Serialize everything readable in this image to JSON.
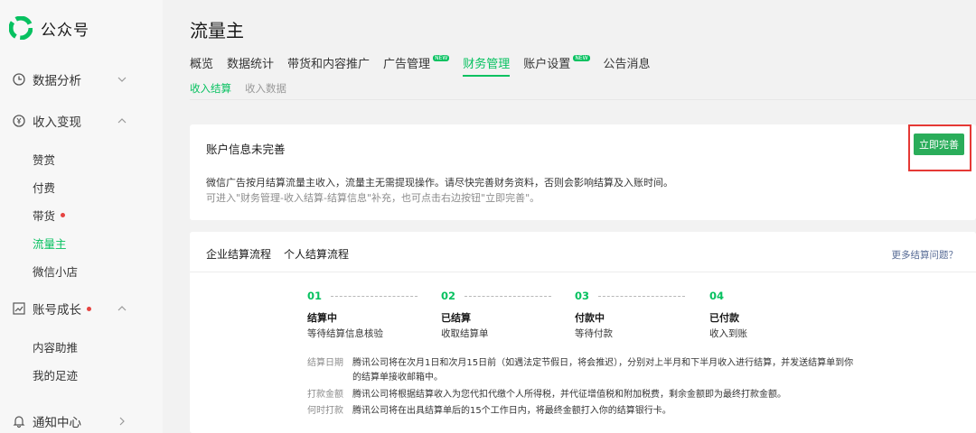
{
  "brand": {
    "name": "公众号",
    "logo_color": "#07c160"
  },
  "sidebar": {
    "groups": [
      {
        "label": "数据分析",
        "icon": "clock-icon",
        "expanded": false,
        "dot": false
      },
      {
        "label": "收入变现",
        "icon": "yuan-icon",
        "expanded": true,
        "dot": false
      },
      {
        "label": "账号成长",
        "icon": "chart-icon",
        "expanded": true,
        "dot": true
      },
      {
        "label": "通知中心",
        "icon": "bell-icon",
        "expanded": false,
        "dot": false
      }
    ],
    "income_items": [
      {
        "label": "赞赏",
        "active": false,
        "dot": false
      },
      {
        "label": "付费",
        "active": false,
        "dot": false
      },
      {
        "label": "带货",
        "active": false,
        "dot": true
      },
      {
        "label": "流量主",
        "active": true,
        "dot": false
      },
      {
        "label": "微信小店",
        "active": false,
        "dot": false
      }
    ],
    "growth_items": [
      {
        "label": "内容助推"
      },
      {
        "label": "我的足迹"
      }
    ]
  },
  "main": {
    "title": "流量主",
    "tabs": [
      {
        "label": "概览",
        "active": false,
        "new": false
      },
      {
        "label": "数据统计",
        "active": false,
        "new": false
      },
      {
        "label": "带货和内容推广",
        "active": false,
        "new": false
      },
      {
        "label": "广告管理",
        "active": false,
        "new": true
      },
      {
        "label": "财务管理",
        "active": true,
        "new": false
      },
      {
        "label": "账户设置",
        "active": false,
        "new": true
      },
      {
        "label": "公告消息",
        "active": false,
        "new": false
      }
    ],
    "new_badge": "NEW",
    "subtabs": [
      {
        "label": "收入结算",
        "active": true
      },
      {
        "label": "收入数据",
        "active": false
      }
    ]
  },
  "notice": {
    "title": "账户信息未完善",
    "desc1": "微信广告按月结算流量主收入，流量主无需提现操作。请尽快完善财务资料，否则会影响结算及入账时间。",
    "desc2": "可进入\"财务管理-收入结算-结算信息\"补充，也可点击右边按钮\"立即完善\"。",
    "button": "立即完善"
  },
  "flow": {
    "tabs": [
      "企业结算流程",
      "个人结算流程"
    ],
    "more_link": "更多结算问题？",
    "steps": [
      {
        "num": "01",
        "title": "结算中",
        "desc": "等待结算信息核验"
      },
      {
        "num": "02",
        "title": "已结算",
        "desc": "收取结算单"
      },
      {
        "num": "03",
        "title": "付款中",
        "desc": "等待付款"
      },
      {
        "num": "04",
        "title": "已付款",
        "desc": "收入到账"
      }
    ],
    "rows": [
      {
        "label": "结算日期",
        "text": "腾讯公司将在次月1日和次月15日前（如遇法定节假日，将会推迟），分别对上半月和下半月收入进行结算，并发送结算单到你"
      },
      {
        "label": "",
        "text": "的结算单接收邮箱中。"
      },
      {
        "label": "打款金额",
        "text": "腾讯公司将根据结算收入为您代扣代缴个人所得税，并代征增值税和附加税费，剩余金额即为最终打款金额。"
      },
      {
        "label": "何时打款",
        "text": "腾讯公司将在出具结算单后的15个工作日内，将最终金额打入你的结算银行卡。"
      }
    ]
  },
  "colors": {
    "accent": "#07c160",
    "button": "#2aad5a",
    "highlight_box": "#e53935",
    "link": "#576b95",
    "dot": "#e64340"
  }
}
